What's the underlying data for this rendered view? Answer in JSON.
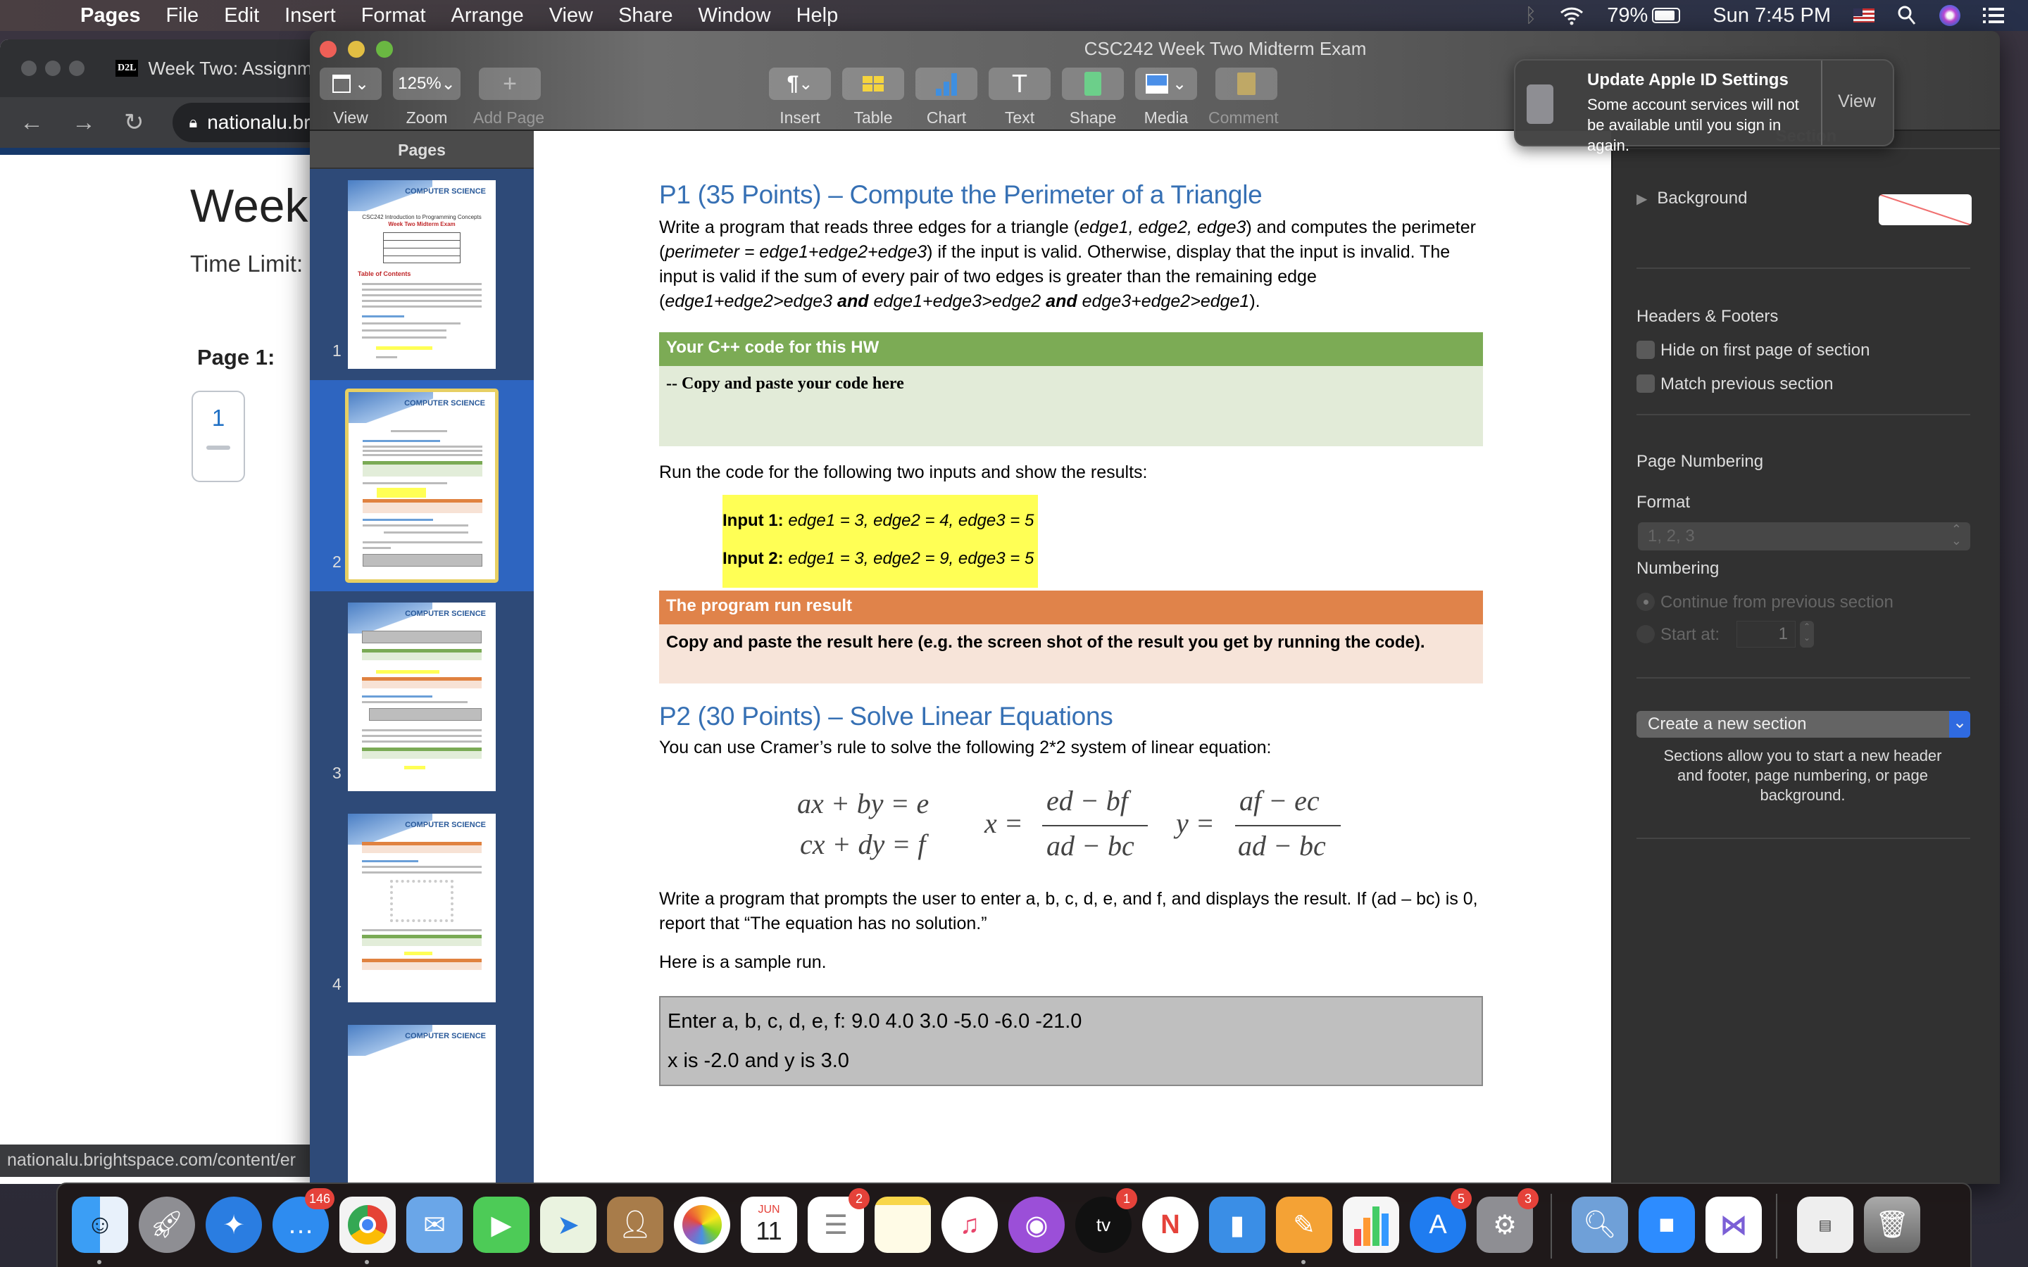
{
  "menubar": {
    "app_name": "Pages",
    "items": [
      "File",
      "Edit",
      "Insert",
      "Format",
      "Arrange",
      "View",
      "Share",
      "Window",
      "Help"
    ],
    "battery": "79%",
    "clock": "Sun 7:45 PM",
    "icons": [
      "bluetooth-icon",
      "wifi-icon",
      "battery-icon",
      "flag-icon",
      "spotlight-icon",
      "siri-icon",
      "notification-center-icon"
    ]
  },
  "browser": {
    "tab_title": "Week Two: Assignm",
    "favicon": "D2L",
    "url": "nationalu.br",
    "page_heading": "Week",
    "time_limit": "Time Limit:",
    "page_label": "Page 1:",
    "page_number": "1",
    "status_url": "nationalu.brightspace.com/content/er"
  },
  "pages_window": {
    "title": "CSC242 Week Two Midterm Exam",
    "toolbar": {
      "view": "View",
      "zoom_value": "125%",
      "zoom": "Zoom",
      "add_page": "Add Page",
      "insert": "Insert",
      "table": "Table",
      "chart": "Chart",
      "text": "Text",
      "shape": "Shape",
      "media": "Media",
      "comment": "Comment"
    },
    "sidebar": {
      "header": "Pages",
      "thumbnails": [
        {
          "number": "1",
          "selected": false,
          "logo": "COMPUTER SCIENCE",
          "title": "CSC242 Introduction to Programming Concepts",
          "subtitle": "Week Two Midterm Exam",
          "toc": "Table of Contents"
        },
        {
          "number": "2",
          "selected": true,
          "logo": "COMPUTER SCIENCE"
        },
        {
          "number": "3",
          "selected": false,
          "logo": "COMPUTER SCIENCE"
        },
        {
          "number": "4",
          "selected": false,
          "logo": "COMPUTER SCIENCE"
        },
        {
          "number": "",
          "selected": false,
          "logo": "COMPUTER SCIENCE"
        }
      ]
    },
    "document": {
      "p1_heading": "P1 (35 Points) – Compute the Perimeter of a Triangle",
      "p1_body": {
        "t1": "Write a program that reads three edges for a triangle (",
        "i1": "edge1, edge2, edge3",
        "t2": ") and computes the perimeter (",
        "i2": "perimeter = edge1+edge2+edge3",
        "t3": ") if the input is valid. Otherwise, display that the input is invalid. The input is valid if the sum of every pair of two edges is greater than the remaining edge (",
        "i3": "edge1+edge2>edge3",
        "b1": "and",
        "i4": "edge1+edge3>edge2",
        "b2": "and",
        "i5": "edge3+edge2>edge1",
        "t4": ")."
      },
      "code_box": {
        "header": "Your C++ code for this HW",
        "body": "--  Copy and paste your code here"
      },
      "run_instructions": "Run the code for the following two inputs and show the results:",
      "inputs": [
        {
          "label": "Input 1:",
          "value": "edge1 = 3, edge2 = 4, edge3 = 5"
        },
        {
          "label": "Input 2:",
          "value": "edge1 = 3, edge2 = 9, edge3 = 5"
        }
      ],
      "result_box": {
        "header": "The program run result",
        "body": "Copy and paste the result here (e.g. the screen shot of the result you get by running the code)."
      },
      "p2_heading": "P2 (30 Points) – Solve Linear Equations",
      "p2_intro": "You can use Cramer’s rule to solve the following 2*2 system of linear equation:",
      "equations": {
        "eq1": "ax + by = e",
        "eq2": "cx + dy = f",
        "x_lhs": "x =",
        "x_num": "ed − bf",
        "x_den": "ad − bc",
        "y_lhs": "y =",
        "y_num": "af − ec",
        "y_den": "ad − bc"
      },
      "p2_body": "Write a program that prompts the user to enter a, b, c, d, e, and f, and displays the result. If (ad – bc) is 0, report that “The equation has no solution.”",
      "sample_intro": "Here is a sample run.",
      "sample_run": [
        "Enter a, b, c, d, e, f: 9.0 4.0 3.0 -5.0 -6.0 -21.0",
        "x is -2.0 and y is 3.0"
      ]
    },
    "inspector": {
      "section_tab": "Section",
      "background": "Background",
      "headers_footers": "Headers & Footers",
      "hide_first_page": "Hide on first page of section",
      "match_previous": "Match previous section",
      "page_numbering": "Page Numbering",
      "format_label": "Format",
      "format_value": "1, 2, 3",
      "numbering_label": "Numbering",
      "continue_option": "Continue from previous section",
      "start_at": "Start at:",
      "start_at_value": "1",
      "create_section": "Create a new section",
      "section_help": "Sections allow you to start a new header and footer, page numbering, or page background."
    }
  },
  "notification": {
    "title": "Update Apple ID Settings",
    "message": "Some account services will not be available until you sign in again.",
    "action": "View"
  },
  "dock": {
    "apps": [
      {
        "name": "Finder",
        "badge": "",
        "running": true
      },
      {
        "name": "Launchpad",
        "badge": "",
        "running": false
      },
      {
        "name": "Safari",
        "badge": "",
        "running": false
      },
      {
        "name": "Messages",
        "badge": "146",
        "running": false
      },
      {
        "name": "Chrome",
        "badge": "",
        "running": true
      },
      {
        "name": "Mail",
        "badge": "",
        "running": false
      },
      {
        "name": "FaceTime",
        "badge": "",
        "running": false
      },
      {
        "name": "Maps",
        "badge": "",
        "running": false
      },
      {
        "name": "Contacts",
        "badge": "",
        "running": false
      },
      {
        "name": "Photos",
        "badge": "",
        "running": false
      },
      {
        "name": "Calendar",
        "badge": "",
        "running": false,
        "month": "JUN",
        "day": "11"
      },
      {
        "name": "Reminders",
        "badge": "2",
        "running": false
      },
      {
        "name": "Notes",
        "badge": "",
        "running": false
      },
      {
        "name": "Music",
        "badge": "",
        "running": false
      },
      {
        "name": "Podcasts",
        "badge": "",
        "running": false
      },
      {
        "name": "TV",
        "badge": "1",
        "running": false
      },
      {
        "name": "News",
        "badge": "",
        "running": false
      },
      {
        "name": "Keynote",
        "badge": "",
        "running": false
      },
      {
        "name": "Pages",
        "badge": "",
        "running": true
      },
      {
        "name": "Numbers",
        "badge": "",
        "running": false
      },
      {
        "name": "App Store",
        "badge": "5",
        "running": false
      },
      {
        "name": "System Preferences",
        "badge": "3",
        "running": false
      },
      {
        "name": "Preview",
        "badge": "",
        "running": false
      },
      {
        "name": "Zoom",
        "badge": "",
        "running": false
      },
      {
        "name": "Visual Studio",
        "badge": "",
        "running": false
      },
      {
        "name": "Pages Document",
        "badge": "",
        "running": false
      },
      {
        "name": "Trash",
        "badge": "",
        "running": false
      }
    ]
  }
}
